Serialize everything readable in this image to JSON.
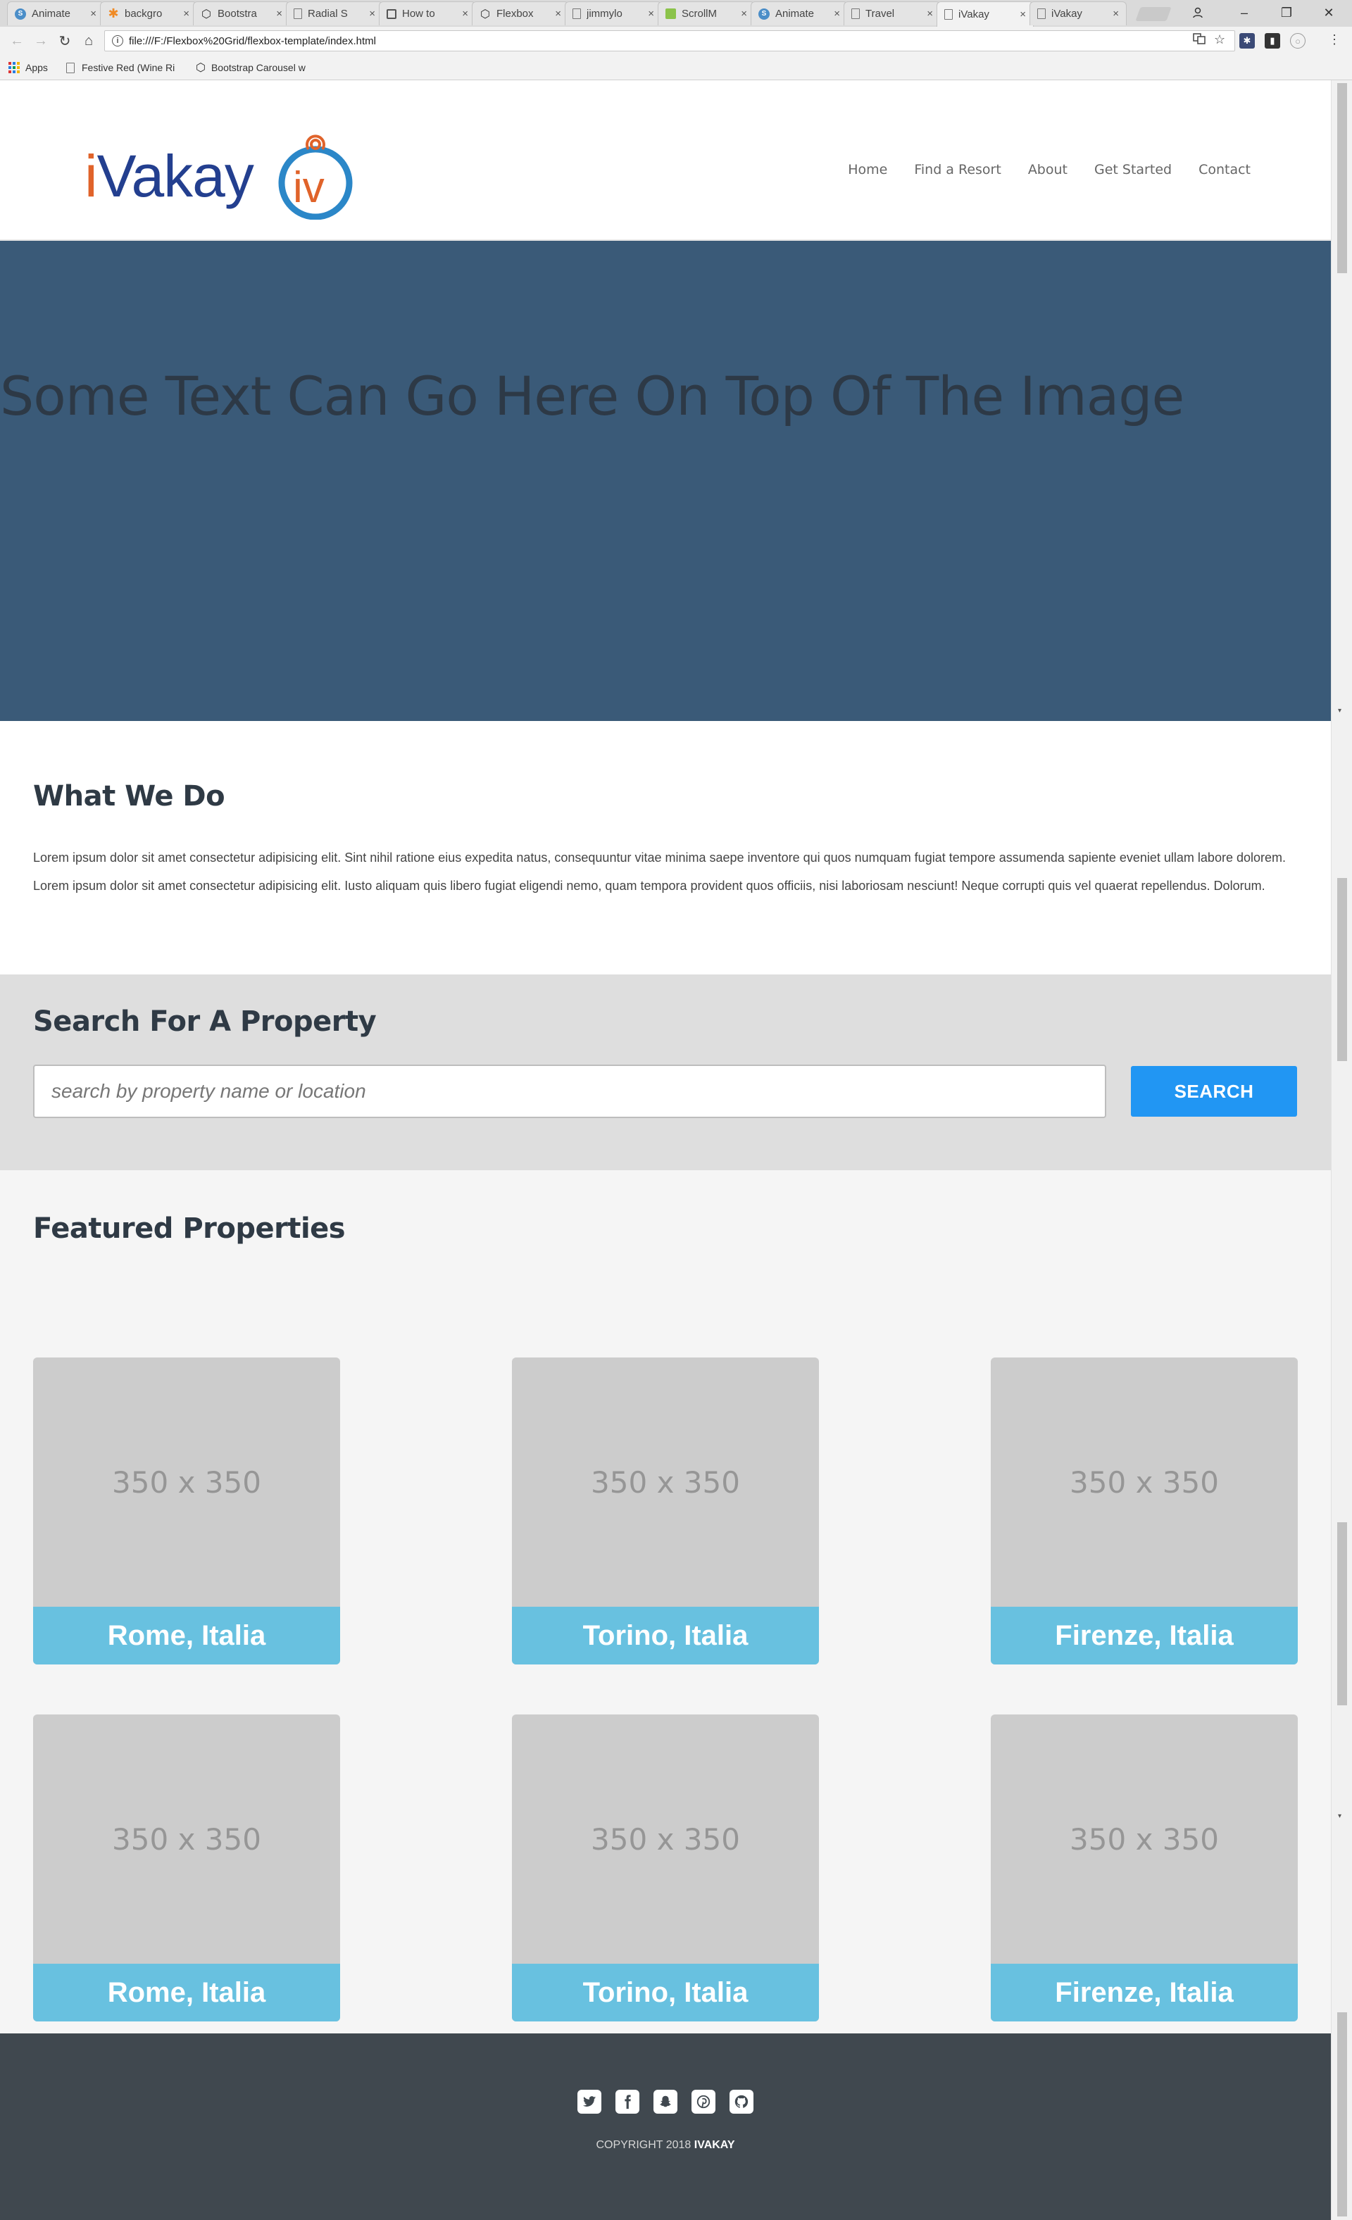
{
  "browser": {
    "tabs": [
      {
        "title": "Animate",
        "icon": "blue-circle-icon",
        "active": false
      },
      {
        "title": "backgro",
        "icon": "asterisk-icon",
        "active": false
      },
      {
        "title": "Bootstra",
        "icon": "codepen-icon",
        "active": false
      },
      {
        "title": "Radial S",
        "icon": "document-icon",
        "active": false
      },
      {
        "title": "How to",
        "icon": "save-icon",
        "active": false
      },
      {
        "title": "Flexbox",
        "icon": "codepen-icon",
        "active": false
      },
      {
        "title": "jimmylo",
        "icon": "document-icon",
        "active": false
      },
      {
        "title": "ScrollM",
        "icon": "green-square-icon",
        "active": false
      },
      {
        "title": "Animate",
        "icon": "blue-circle-icon",
        "active": false
      },
      {
        "title": "Travel",
        "icon": "document-icon",
        "active": false
      },
      {
        "title": "iVakay",
        "icon": "document-icon",
        "active": true
      },
      {
        "title": "iVakay",
        "icon": "document-icon",
        "active": false
      }
    ],
    "url": "file:///F:/Flexbox%20Grid/flexbox-template/index.html",
    "bookmarks": [
      {
        "label": "Apps",
        "icon": "apps-grid-icon"
      },
      {
        "label": "Festive Red (Wine Ri",
        "icon": "document-icon"
      },
      {
        "label": "Bootstrap Carousel w",
        "icon": "codepen-icon"
      }
    ]
  },
  "header": {
    "logo_text_i": "i",
    "logo_text_rest": "Vakay",
    "logo_mark_letters": "iv",
    "nav": [
      "Home",
      "Find a Resort",
      "About",
      "Get Started",
      "Contact"
    ]
  },
  "hero": {
    "text": "Some Text Can Go Here On Top Of The Image",
    "background": "#3a5a78"
  },
  "what_we_do": {
    "title": "What We Do",
    "body": "Lorem ipsum dolor sit amet consectetur adipisicing elit. Sint nihil ratione eius expedita natus, consequuntur vitae minima saepe inventore qui quos numquam fugiat tempore assumenda sapiente eveniet ullam labore dolorem. Lorem ipsum dolor sit amet consectetur adipisicing elit. Iusto aliquam quis libero fugiat eligendi nemo, quam tempora provident quos officiis, nisi laboriosam nesciunt! Neque corrupti quis vel quaerat repellendus. Dolorum."
  },
  "search": {
    "title": "Search For A Property",
    "placeholder": "search by property name or location",
    "value": "",
    "button_label": "SEARCH"
  },
  "featured": {
    "title": "Featured Properties",
    "properties": [
      {
        "image_text": "350 x 350",
        "caption": "Rome, Italia"
      },
      {
        "image_text": "350 x 350",
        "caption": "Torino, Italia"
      },
      {
        "image_text": "350 x 350",
        "caption": "Firenze, Italia"
      },
      {
        "image_text": "350 x 350",
        "caption": "Rome, Italia"
      },
      {
        "image_text": "350 x 350",
        "caption": "Torino, Italia"
      },
      {
        "image_text": "350 x 350",
        "caption": "Firenze, Italia"
      }
    ]
  },
  "footer": {
    "social": [
      "twitter-icon",
      "facebook-icon",
      "snapchat-icon",
      "pinterest-icon",
      "github-icon"
    ],
    "copyright_prefix": "COPYRIGHT 2018",
    "copyright_brand": "IVAKAY"
  },
  "colors": {
    "brand_blue": "#233f8f",
    "brand_orange": "#e0632a",
    "search_button": "#2196f3",
    "card_caption": "#68c1e0",
    "footer_bg": "#40484f"
  }
}
